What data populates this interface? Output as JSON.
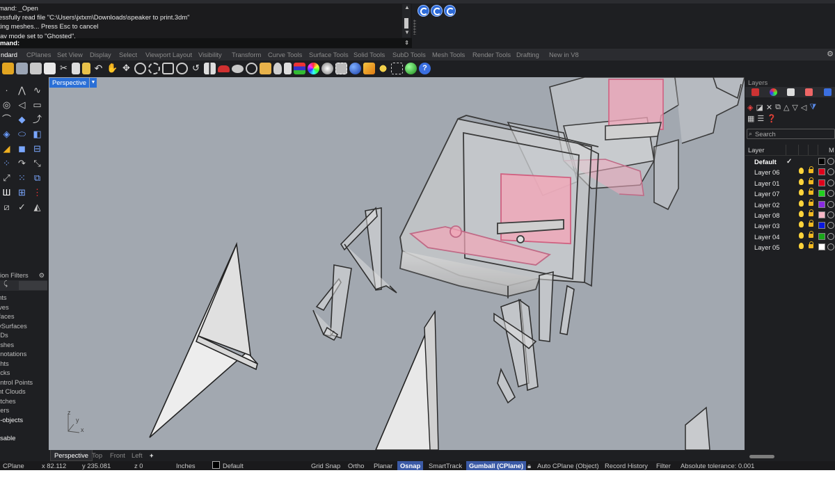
{
  "command": {
    "history": [
      "mand: _Open",
      "essfully read file \"C:\\Users\\jxtxm\\Downloads\\speaker to print.3dm\"",
      "ting meshes... Press Esc to cancel",
      "lay mode set to \"Ghosted\"."
    ],
    "prompt": "mand:"
  },
  "tabs": [
    {
      "label": "ndard",
      "active": true
    },
    {
      "label": "CPlanes"
    },
    {
      "label": "Set View"
    },
    {
      "label": "Display"
    },
    {
      "label": "Select"
    },
    {
      "label": "Viewport Layout"
    },
    {
      "label": "Visibility"
    },
    {
      "label": "Transform"
    },
    {
      "label": "Curve Tools"
    },
    {
      "label": "Surface Tools"
    },
    {
      "label": "Solid Tools"
    },
    {
      "label": "SubD Tools"
    },
    {
      "label": "Mesh Tools"
    },
    {
      "label": "Render Tools"
    },
    {
      "label": "Drafting"
    },
    {
      "label": "New in V8"
    }
  ],
  "toolbar_icons": [
    "open-icon",
    "save-icon",
    "print-icon",
    "document-properties-icon",
    "cut-icon",
    "copy-icon",
    "paste-icon",
    "undo-icon",
    "pan-icon",
    "rotate-view-icon",
    "zoom-icon",
    "zoom-window-icon",
    "zoom-extents-icon",
    "zoom-selected-icon",
    "undo-view-icon",
    "four-viewports-icon",
    "car-icon",
    "wireframe-icon",
    "shaded-icon",
    "ghosted-icon",
    "light-icon",
    "lock-icon",
    "layer-icon",
    "color-wheel-icon",
    "render-icon",
    "environment-icon",
    "material-icon",
    "paint-icon",
    "options-icon",
    "grid-icon",
    "help-icon"
  ],
  "selection_filters": {
    "title": "ion Filters",
    "items": [
      "ints",
      "rves",
      "rfaces",
      "lySurfaces",
      "bDs",
      "eshes",
      "nnotations",
      "ghts",
      "ocks",
      "ontrol Points",
      "int Clouds",
      "atches",
      "hers",
      "b-objects"
    ],
    "highlighted": "b-objects",
    "disable_label": "sable"
  },
  "viewport": {
    "title": "Perspective",
    "axis_x": "x",
    "axis_y": "y",
    "axis_z": "z"
  },
  "viewport_tabs": [
    "Perspective",
    "Top",
    "Front",
    "Left",
    "+"
  ],
  "layers": {
    "panel_title": "Layers",
    "search_placeholder": "Search",
    "header_layer": "Layer",
    "header_m": "M",
    "rows": [
      {
        "name": "Default",
        "current": true,
        "color": "#000000"
      },
      {
        "name": "Layer 06",
        "color": "#e0001b"
      },
      {
        "name": "Layer 01",
        "color": "#e0001b"
      },
      {
        "name": "Layer 07",
        "color": "#22d11f"
      },
      {
        "name": "Layer 02",
        "color": "#8a2be2"
      },
      {
        "name": "Layer 08",
        "color": "#f7b7c6"
      },
      {
        "name": "Layer 03",
        "color": "#0a18e0"
      },
      {
        "name": "Layer 04",
        "color": "#1aa61a"
      },
      {
        "name": "Layer 05",
        "color": "#ffffff"
      }
    ]
  },
  "status": {
    "cplane": "CPlane",
    "x": "x 82.112",
    "y": "y 235.081",
    "z": "z 0",
    "units": "Inches",
    "layer": "Default",
    "grid_snap": "Grid Snap",
    "ortho": "Ortho",
    "planar": "Planar",
    "osnap": "Osnap",
    "smarttrack": "SmartTrack",
    "gumball": "Gumball (CPlane)",
    "autocplane": "Auto CPlane (Object)",
    "record_history": "Record History",
    "filter": "Filter",
    "tolerance": "Absolute tolerance: 0.001"
  },
  "colors": {
    "accent": "#2a6fd6",
    "viewport_bg": "#a2a8b0",
    "selection_pink": "#f2a6b8"
  }
}
